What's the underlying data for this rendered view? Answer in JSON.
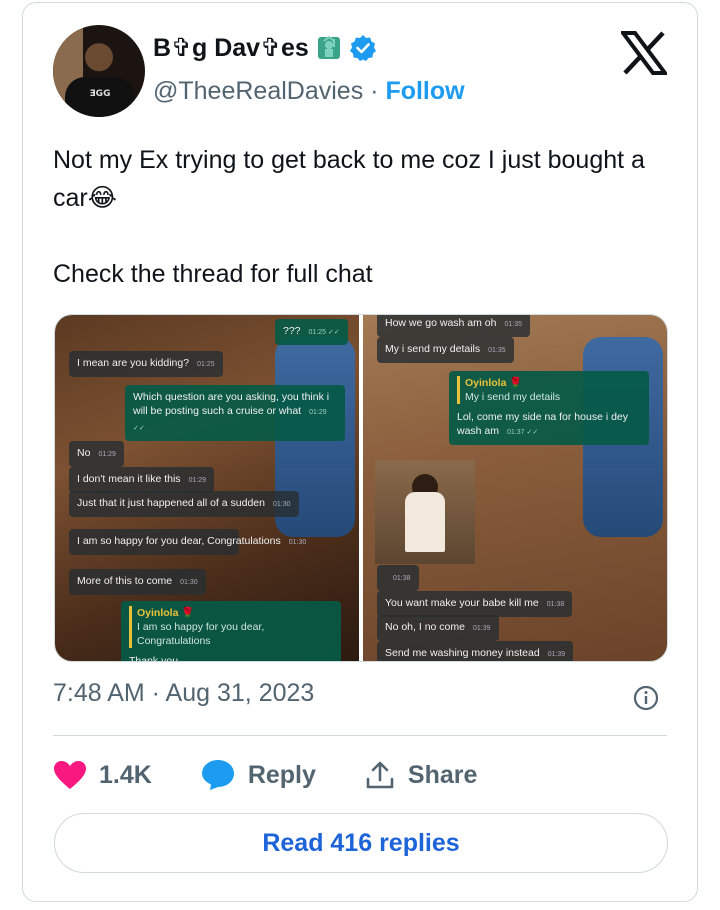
{
  "author": {
    "display_name": "B✞g Dav✞es",
    "handle": "@TheeRealDavies",
    "separator": "·",
    "follow_label": "Follow",
    "verified": true,
    "avatar_text": "ƎGG"
  },
  "tweet": {
    "text_line1": "Not my Ex trying to get back to me coz I just bought a car😂",
    "text_line2": "Check the thread for full chat",
    "timestamp": "7:48 AM · Aug 31, 2023"
  },
  "media": {
    "left_chat": [
      {
        "text": "???",
        "time": "01:25 ✓✓",
        "me": true
      },
      {
        "text": "I mean are you kidding?",
        "time": "01:25",
        "me": false
      },
      {
        "text": "Which question are you asking, you think i will be posting such a cruise or what",
        "time": "01:29 ✓✓",
        "me": true
      },
      {
        "text": "No",
        "time": "01:29",
        "me": false
      },
      {
        "text": "I don't mean it like this",
        "time": "01:29",
        "me": false
      },
      {
        "text": "Just that it just happened all of a sudden",
        "time": "01:30",
        "me": false
      },
      {
        "text": "I am so happy for you dear, Congratulations",
        "time": "01:30",
        "me": false
      },
      {
        "text": "More of this to come",
        "time": "01:30",
        "me": false
      },
      {
        "quote_name": "Oyinlola 🌹",
        "quote_text": "I am so happy for you dear, Congratulations",
        "text": "Thank you",
        "time": "",
        "me": true
      }
    ],
    "right_chat": [
      {
        "text": "How we go wash am oh",
        "time": "01:35",
        "me": false
      },
      {
        "text": "My i send my details",
        "time": "01:35",
        "me": false
      },
      {
        "quote_name": "Oyinlola 🌹",
        "quote_text": "My i send my details",
        "text": "Lol, come my side na for house i dey wash am",
        "time": "01:37 ✓✓",
        "me": true
      },
      {
        "text": "",
        "time": "01:38",
        "me": false
      },
      {
        "text": "You want make your babe kill me",
        "time": "01:38",
        "me": false
      },
      {
        "text": "No oh, I no come",
        "time": "01:39",
        "me": false
      },
      {
        "text": "Send me washing money instead",
        "time": "01:39",
        "me": false
      }
    ]
  },
  "actions": {
    "likes": "1.4K",
    "reply_label": "Reply",
    "share_label": "Share"
  },
  "read_replies_label": "Read 416 replies",
  "colors": {
    "accent": "#1d9bf0",
    "like": "#f91880",
    "text": "#0f1419",
    "muted": "#536471",
    "border": "#cfd9de"
  },
  "icons": [
    "x-logo-icon",
    "verified-badge-icon",
    "statue-of-liberty-icon",
    "info-icon",
    "heart-icon",
    "reply-bubble-icon",
    "share-icon"
  ]
}
